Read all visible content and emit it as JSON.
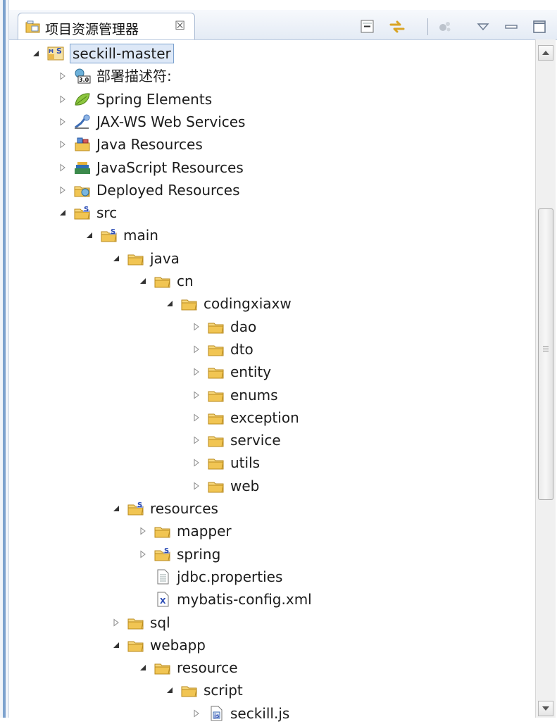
{
  "view": {
    "title": "项目资源管理器",
    "close_glyph": "☒"
  },
  "toolbar": [
    {
      "name": "collapse-all-icon"
    },
    {
      "name": "link-with-editor-icon"
    },
    {
      "name": "customize-view-icon"
    },
    {
      "name": "view-menu-icon"
    },
    {
      "name": "minimize-icon"
    },
    {
      "name": "maximize-icon"
    }
  ],
  "tree": [
    {
      "label": "seckill-master",
      "depth": 0,
      "twisty": "expanded",
      "icon": "project-icon",
      "selected": true
    },
    {
      "label": "部署描述符:",
      "depth": 1,
      "twisty": "collapsed",
      "icon": "deployment-descriptor-icon"
    },
    {
      "label": "Spring Elements",
      "depth": 1,
      "twisty": "collapsed",
      "icon": "spring-leaf-icon"
    },
    {
      "label": "JAX-WS Web Services",
      "depth": 1,
      "twisty": "collapsed",
      "icon": "web-services-icon"
    },
    {
      "label": "Java Resources",
      "depth": 1,
      "twisty": "collapsed",
      "icon": "java-resources-icon"
    },
    {
      "label": "JavaScript Resources",
      "depth": 1,
      "twisty": "collapsed",
      "icon": "javascript-resources-icon"
    },
    {
      "label": "Deployed Resources",
      "depth": 1,
      "twisty": "collapsed",
      "icon": "deployed-resources-icon"
    },
    {
      "label": "src",
      "depth": 1,
      "twisty": "expanded",
      "icon": "spring-folder-icon"
    },
    {
      "label": "main",
      "depth": 2,
      "twisty": "expanded",
      "icon": "spring-folder-icon"
    },
    {
      "label": "java",
      "depth": 3,
      "twisty": "expanded",
      "icon": "folder-icon"
    },
    {
      "label": "cn",
      "depth": 4,
      "twisty": "expanded",
      "icon": "folder-icon"
    },
    {
      "label": "codingxiaxw",
      "depth": 5,
      "twisty": "expanded",
      "icon": "folder-icon"
    },
    {
      "label": "dao",
      "depth": 6,
      "twisty": "collapsed",
      "icon": "folder-icon"
    },
    {
      "label": "dto",
      "depth": 6,
      "twisty": "collapsed",
      "icon": "folder-icon"
    },
    {
      "label": "entity",
      "depth": 6,
      "twisty": "collapsed",
      "icon": "folder-icon"
    },
    {
      "label": "enums",
      "depth": 6,
      "twisty": "collapsed",
      "icon": "folder-icon"
    },
    {
      "label": "exception",
      "depth": 6,
      "twisty": "collapsed",
      "icon": "folder-icon"
    },
    {
      "label": "service",
      "depth": 6,
      "twisty": "collapsed",
      "icon": "folder-icon"
    },
    {
      "label": "utils",
      "depth": 6,
      "twisty": "collapsed",
      "icon": "folder-icon"
    },
    {
      "label": "web",
      "depth": 6,
      "twisty": "collapsed",
      "icon": "folder-icon"
    },
    {
      "label": "resources",
      "depth": 3,
      "twisty": "expanded",
      "icon": "spring-folder-icon"
    },
    {
      "label": "mapper",
      "depth": 4,
      "twisty": "collapsed",
      "icon": "folder-icon"
    },
    {
      "label": "spring",
      "depth": 4,
      "twisty": "collapsed",
      "icon": "spring-folder-icon"
    },
    {
      "label": "jdbc.properties",
      "depth": 4,
      "twisty": "none",
      "icon": "properties-file-icon"
    },
    {
      "label": "mybatis-config.xml",
      "depth": 4,
      "twisty": "none",
      "icon": "xml-file-icon"
    },
    {
      "label": "sql",
      "depth": 3,
      "twisty": "collapsed",
      "icon": "folder-icon"
    },
    {
      "label": "webapp",
      "depth": 3,
      "twisty": "expanded",
      "icon": "folder-icon"
    },
    {
      "label": "resource",
      "depth": 4,
      "twisty": "expanded",
      "icon": "folder-icon"
    },
    {
      "label": "script",
      "depth": 5,
      "twisty": "expanded",
      "icon": "folder-icon"
    },
    {
      "label": "seckill.js",
      "depth": 6,
      "twisty": "collapsed",
      "icon": "js-file-icon"
    }
  ],
  "colors": {
    "selection": "#dde8f7",
    "selection_border": "#7da2ce",
    "folder": "#f1c553"
  }
}
